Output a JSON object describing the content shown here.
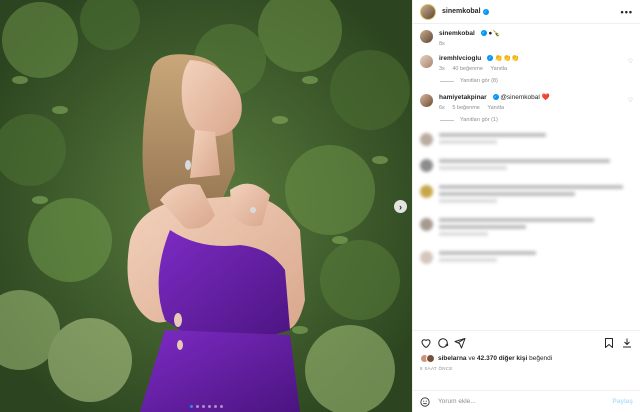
{
  "post": {
    "author": "sinemkobal",
    "more_label": "•••",
    "caption_emoji": "●🍾",
    "caption_time": "8s"
  },
  "comments": [
    {
      "user": "iremhlvcioglu",
      "text": "👏👏👏",
      "time": "3s",
      "likes": "40 beğenme",
      "reply": "Yanıtla",
      "replies": "Yanıtları gör (8)"
    },
    {
      "user": "hamiyetakpinar",
      "text": "@sinemkobal ❤️",
      "time": "6s",
      "likes": "5 beğenme",
      "reply": "Yanıtla",
      "replies": "Yanıtları gör (1)"
    }
  ],
  "likes": {
    "user": "sibelarna",
    "connector": "ve",
    "others": "42.370 diğer kişi",
    "suffix": "beğendi"
  },
  "time_label": "8 SAAT ÖNCE",
  "compose": {
    "placeholder": "Yorum ekle...",
    "share_label": "Paylaş"
  },
  "carousel": {
    "next_label": "›",
    "total": 6,
    "active": 0
  },
  "colors": {
    "accent": "#0095f6",
    "dress": "#6a1fa8",
    "foliage": "#3d5a2c"
  },
  "icons": [
    "more-icon",
    "verified-icon",
    "heart-icon",
    "comment-icon",
    "share-icon",
    "save-icon",
    "emoji-icon",
    "chevron-right-icon"
  ]
}
